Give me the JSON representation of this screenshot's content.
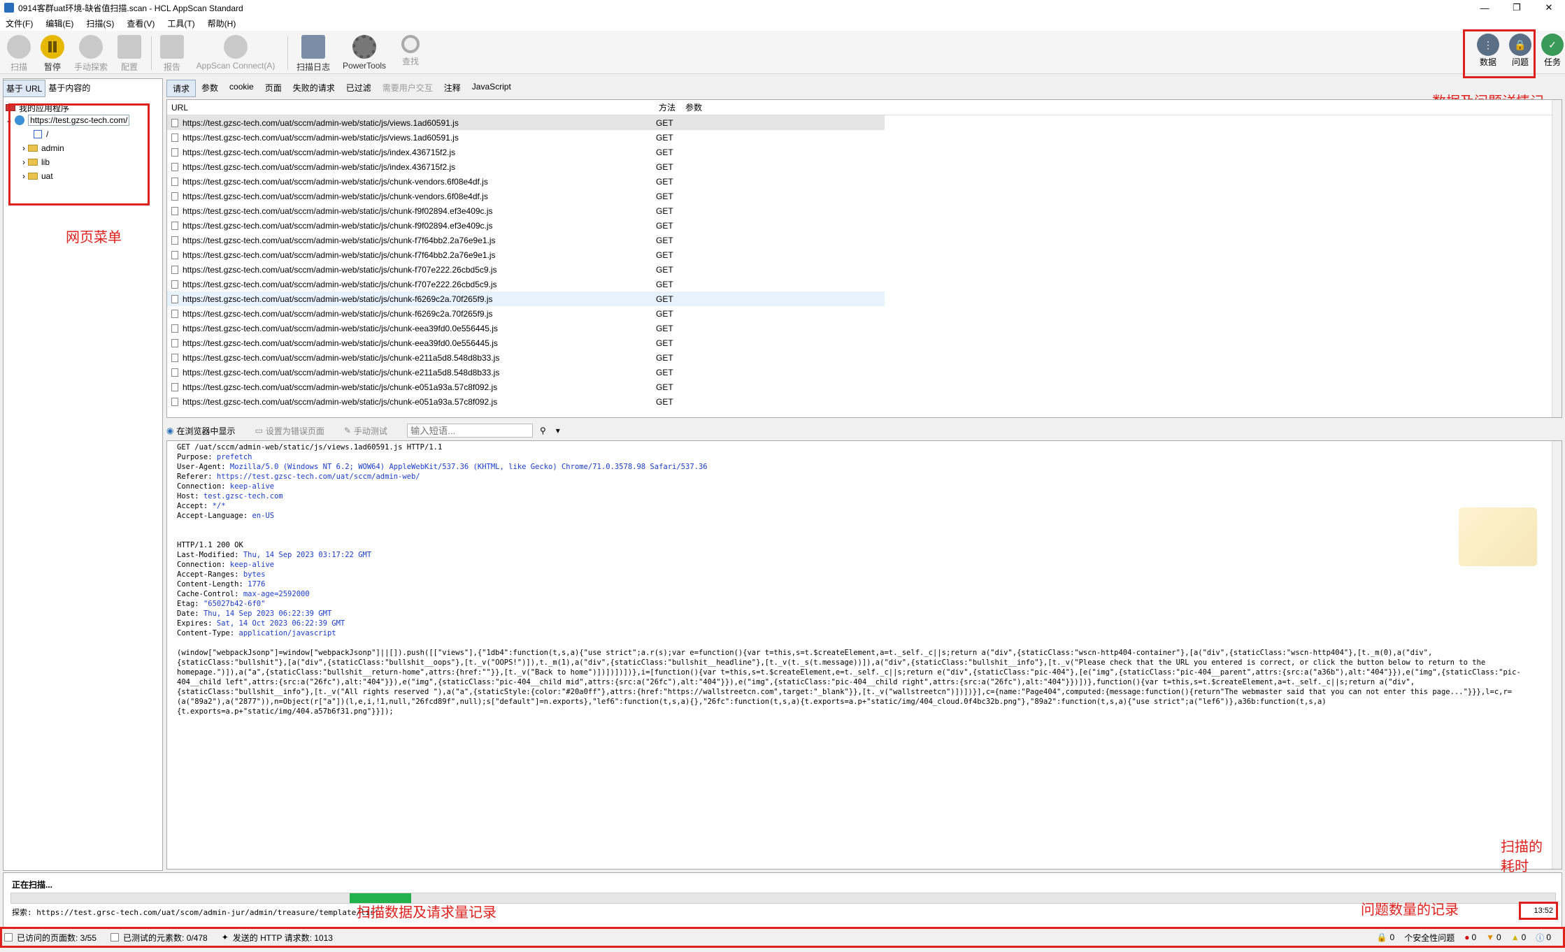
{
  "window": {
    "title": "0914客群uat环境-缺省值扫描.scan - HCL AppScan Standard"
  },
  "menu": [
    "文件(F)",
    "编辑(E)",
    "扫描(S)",
    "查看(V)",
    "工具(T)",
    "帮助(H)"
  ],
  "toolbar": {
    "scan": "扫描",
    "pause": "暂停",
    "manual_explore": "手动探索",
    "config": "配置",
    "report": "报告",
    "appscan_connect": "AppScan Connect(A)",
    "scan_log": "扫描日志",
    "powertools": "PowerTools",
    "find": "查找",
    "data": "数据",
    "issues": "问题",
    "tasks": "任务"
  },
  "left_tabs": {
    "by_url": "基于 URL",
    "by_content": "基于内容的"
  },
  "tree": {
    "root": "我的应用程序",
    "host": "https://test.gzsc-tech.com/",
    "items": [
      "/",
      "admin",
      "lib",
      "uat"
    ]
  },
  "request_tabs": [
    "请求",
    "参数",
    "cookie",
    "页面",
    "失败的请求",
    "已过滤",
    "需要用户交互",
    "注释",
    "JavaScript"
  ],
  "grid": {
    "headers": {
      "url": "URL",
      "method": "方法",
      "params": "参数"
    },
    "rows": [
      {
        "url": "https://test.gzsc-tech.com/uat/sccm/admin-web/static/js/views.1ad60591.js",
        "method": "GET"
      },
      {
        "url": "https://test.gzsc-tech.com/uat/sccm/admin-web/static/js/views.1ad60591.js",
        "method": "GET"
      },
      {
        "url": "https://test.gzsc-tech.com/uat/sccm/admin-web/static/js/index.436715f2.js",
        "method": "GET"
      },
      {
        "url": "https://test.gzsc-tech.com/uat/sccm/admin-web/static/js/index.436715f2.js",
        "method": "GET"
      },
      {
        "url": "https://test.gzsc-tech.com/uat/sccm/admin-web/static/js/chunk-vendors.6f08e4df.js",
        "method": "GET"
      },
      {
        "url": "https://test.gzsc-tech.com/uat/sccm/admin-web/static/js/chunk-vendors.6f08e4df.js",
        "method": "GET"
      },
      {
        "url": "https://test.gzsc-tech.com/uat/sccm/admin-web/static/js/chunk-f9f02894.ef3e409c.js",
        "method": "GET"
      },
      {
        "url": "https://test.gzsc-tech.com/uat/sccm/admin-web/static/js/chunk-f9f02894.ef3e409c.js",
        "method": "GET"
      },
      {
        "url": "https://test.gzsc-tech.com/uat/sccm/admin-web/static/js/chunk-f7f64bb2.2a76e9e1.js",
        "method": "GET"
      },
      {
        "url": "https://test.gzsc-tech.com/uat/sccm/admin-web/static/js/chunk-f7f64bb2.2a76e9e1.js",
        "method": "GET"
      },
      {
        "url": "https://test.gzsc-tech.com/uat/sccm/admin-web/static/js/chunk-f707e222.26cbd5c9.js",
        "method": "GET"
      },
      {
        "url": "https://test.gzsc-tech.com/uat/sccm/admin-web/static/js/chunk-f707e222.26cbd5c9.js",
        "method": "GET"
      },
      {
        "url": "https://test.gzsc-tech.com/uat/sccm/admin-web/static/js/chunk-f6269c2a.70f265f9.js",
        "method": "GET"
      },
      {
        "url": "https://test.gzsc-tech.com/uat/sccm/admin-web/static/js/chunk-f6269c2a.70f265f9.js",
        "method": "GET"
      },
      {
        "url": "https://test.gzsc-tech.com/uat/sccm/admin-web/static/js/chunk-eea39fd0.0e556445.js",
        "method": "GET"
      },
      {
        "url": "https://test.gzsc-tech.com/uat/sccm/admin-web/static/js/chunk-eea39fd0.0e556445.js",
        "method": "GET"
      },
      {
        "url": "https://test.gzsc-tech.com/uat/sccm/admin-web/static/js/chunk-e211a5d8.548d8b33.js",
        "method": "GET"
      },
      {
        "url": "https://test.gzsc-tech.com/uat/sccm/admin-web/static/js/chunk-e211a5d8.548d8b33.js",
        "method": "GET"
      },
      {
        "url": "https://test.gzsc-tech.com/uat/sccm/admin-web/static/js/chunk-e051a93a.57c8f092.js",
        "method": "GET"
      },
      {
        "url": "https://test.gzsc-tech.com/uat/sccm/admin-web/static/js/chunk-e051a93a.57c8f092.js",
        "method": "GET"
      }
    ]
  },
  "detail_toolbar": {
    "show_in_browser": "在浏览器中显示",
    "set_error_page": "设置为错误页面",
    "manual_test": "手动测试",
    "search_placeholder": "输入短语..."
  },
  "detail": {
    "request_line": "GET /uat/sccm/admin-web/static/js/views.1ad60591.js HTTP/1.1",
    "request_headers": [
      {
        "k": "Purpose:",
        "v": "prefetch"
      },
      {
        "k": "User-Agent:",
        "v": "Mozilla/5.0 (Windows NT 6.2; WOW64) AppleWebKit/537.36 (KHTML, like Gecko) Chrome/71.0.3578.98 Safari/537.36"
      },
      {
        "k": "Referer:",
        "v": "https://test.gzsc-tech.com/uat/sccm/admin-web/"
      },
      {
        "k": "Connection:",
        "v": "keep-alive"
      },
      {
        "k": "Host:",
        "v": "test.gzsc-tech.com"
      },
      {
        "k": "Accept:",
        "v": "*/*"
      },
      {
        "k": "Accept-Language:",
        "v": "en-US"
      }
    ],
    "status_line": "HTTP/1.1 200 OK",
    "response_headers": [
      {
        "k": "Last-Modified:",
        "v": "Thu, 14 Sep 2023 03:17:22 GMT"
      },
      {
        "k": "Connection:",
        "v": "keep-alive"
      },
      {
        "k": "Accept-Ranges:",
        "v": "bytes"
      },
      {
        "k": "Content-Length:",
        "v": "1776"
      },
      {
        "k": "Cache-Control:",
        "v": "max-age=2592000"
      },
      {
        "k": "Etag:",
        "v": "\"65027b42-6f0\""
      },
      {
        "k": "Date:",
        "v": "Thu, 14 Sep 2023 06:22:39 GMT"
      },
      {
        "k": "Expires:",
        "v": "Sat, 14 Oct 2023 06:22:39 GMT"
      },
      {
        "k": "Content-Type:",
        "v": "application/javascript"
      }
    ],
    "body": "(window[\"webpackJsonp\"]=window[\"webpackJsonp\"]||[]).push([[\"views\"],{\"1db4\":function(t,s,a){\"use strict\";a.r(s);var e=function(){var t=this,s=t.$createElement,a=t._self._c||s;return a(\"div\",{staticClass:\"wscn-http404-container\"},[a(\"div\",{staticClass:\"wscn-http404\"},[t._m(0),a(\"div\",{staticClass:\"bullshit\"},[a(\"div\",{staticClass:\"bullshit__oops\"},[t._v(\"OOPS!\")]),t._m(1),a(\"div\",{staticClass:\"bullshit__headline\"},[t._v(t._s(t.message))]),a(\"div\",{staticClass:\"bullshit__info\"},[t._v(\"Please check that the URL you entered is correct, or click the button below to return to the homepage.\")]),a(\"a\",{staticClass:\"bullshit__return-home\",attrs:{href:\"\"}},[t._v(\"Back to home\")])])])])},i=[function(){var t=this,s=t.$createElement,e=t._self._c||s;return e(\"div\",{staticClass:\"pic-404\"},[e(\"img\",{staticClass:\"pic-404__parent\",attrs:{src:a(\"a36b\"),alt:\"404\"}}),e(\"img\",{staticClass:\"pic-404__child left\",attrs:{src:a(\"26fc\"),alt:\"404\"}}),e(\"img\",{staticClass:\"pic-404__child mid\",attrs:{src:a(\"26fc\"),alt:\"404\"}}),e(\"img\",{staticClass:\"pic-404__child right\",attrs:{src:a(\"26fc\"),alt:\"404\"}})])},function(){var t=this,s=t.$createElement,a=t._self._c||s;return a(\"div\",{staticClass:\"bullshit__info\"},[t._v(\"All rights reserved \"),a(\"a\",{staticStyle:{color:\"#20a0ff\"},attrs:{href:\"https://wallstreetcn.com\",target:\"_blank\"}},[t._v(\"wallstreetcn\")])])}],c={name:\"Page404\",computed:{message:function(){return\"The webmaster said that you can not enter this page...\"}}},l=c,r=(a(\"89a2\"),a(\"2877\")),n=Object(r[\"a\"])(l,e,i,!1,null,\"26fcd89f\",null);s[\"default\"]=n.exports},\"lef6\":function(t,s,a){},\"26fc\":function(t,s,a){t.exports=a.p+\"static/img/404_cloud.0f4bc32b.png\"},\"89a2\":function(t,s,a){\"use strict\";a(\"lef6\")},a36b:function(t,s,a){t.exports=a.p+\"static/img/404.a57b6f31.png\"}}]);"
  },
  "status": {
    "scanning": "正在扫描...",
    "explore": "探索: https://test.grsc-tech.com/uat/scom/admin-jur/admin/treasure/template/list",
    "elapsed": "13:52",
    "progress": 0.04,
    "pages_visited": "已访问的页面数: 3/55",
    "elements_tested": "已测试的元素数: 0/478",
    "http_requests": "发送的 HTTP 请求数: 1013",
    "issues": [
      "0",
      "个安全性问题",
      "0",
      "0",
      "0",
      "0"
    ]
  },
  "annotations": {
    "data_issues": "数据及问题详情记录",
    "web_menu": "网页菜单",
    "scan_time": "扫描的耗时",
    "issue_count": "问题数量的记录",
    "scan_data": "扫描数据及请求量记录"
  },
  "colors": {
    "accent": "#2a6ebb",
    "annotation": "#e0201c",
    "progress": "#22b14c",
    "header_value": "#1a3dcc"
  }
}
